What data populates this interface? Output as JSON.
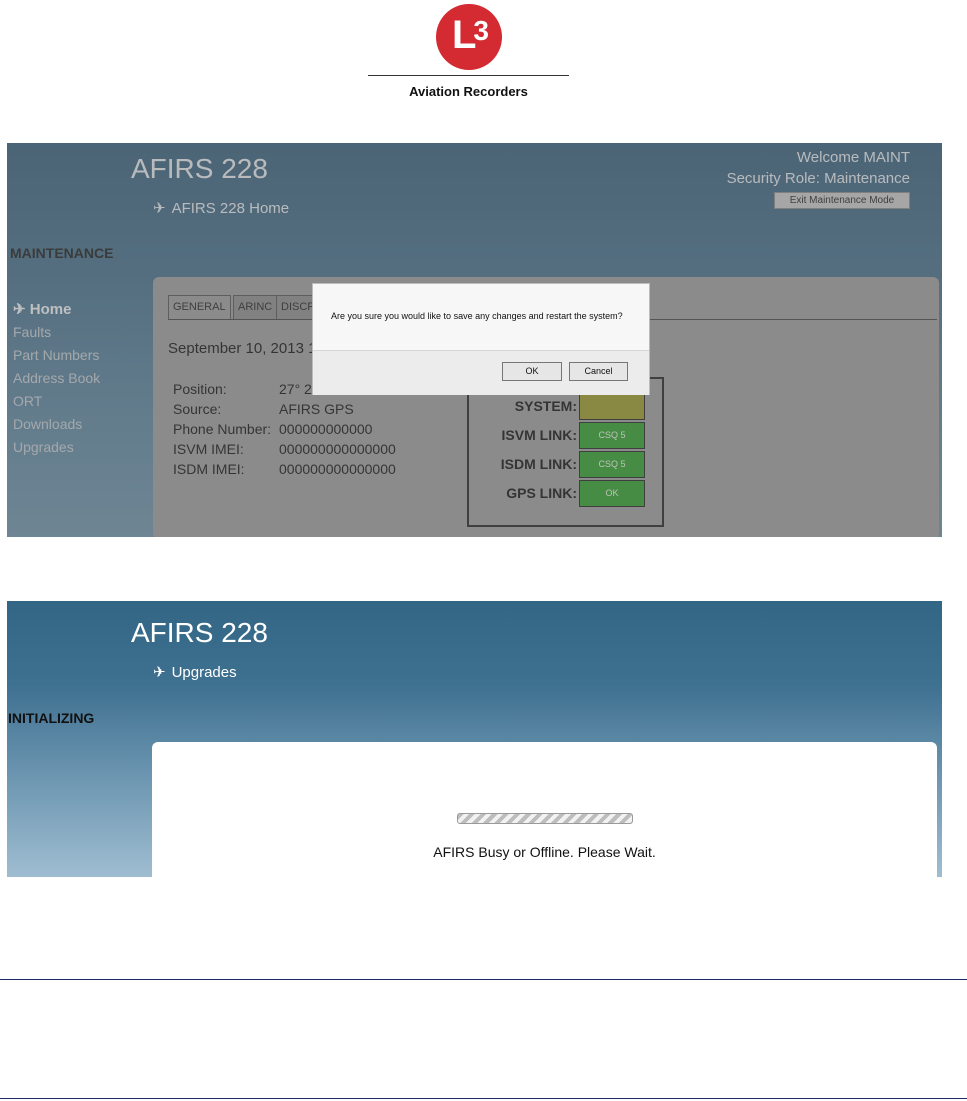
{
  "logo": {
    "mark_letter": "L",
    "mark_number": "3",
    "caption": "Aviation Recorders",
    "color": "#d42a32"
  },
  "screen1": {
    "app_title": "AFIRS 228",
    "breadcrumb": "AFIRS 228 Home",
    "welcome": "Welcome MAINT",
    "security_role": "Security Role: Maintenance",
    "exit_button": "Exit Maintenance Mode",
    "mode_label": "MAINTENANCE",
    "nav": [
      "Home",
      "Faults",
      "Part Numbers",
      "Address Book",
      "ORT",
      "Downloads",
      "Upgrades"
    ],
    "tabs": [
      "GENERAL",
      "ARINC",
      "DISCR"
    ],
    "date_text": "September 10, 2013 1",
    "info": [
      {
        "label": "Position:",
        "value": "27° 2"
      },
      {
        "label": "Source:",
        "value": "AFIRS GPS"
      },
      {
        "label": "Phone Number:",
        "value": "000000000000"
      },
      {
        "label": "ISVM IMEI:",
        "value": "000000000000000"
      },
      {
        "label": "ISDM IMEI:",
        "value": "000000000000000"
      }
    ],
    "status": [
      {
        "label": "SYSTEM:",
        "value": "",
        "color": "#9c9a2a"
      },
      {
        "label": "ISVM LINK:",
        "value": "CSQ 5",
        "color": "#2f9e2a"
      },
      {
        "label": "ISDM LINK:",
        "value": "CSQ 5",
        "color": "#2f9e2a"
      },
      {
        "label": "GPS LINK:",
        "value": "OK",
        "color": "#2f9e2a"
      }
    ],
    "dialog": {
      "message": "Are you sure you would like to save any changes and restart the system?",
      "ok_label": "OK",
      "cancel_label": "Cancel"
    }
  },
  "screen2": {
    "app_title": "AFIRS 228",
    "breadcrumb": "Upgrades",
    "mode_label": "INITIALIZING",
    "status_message": "AFIRS Busy or Offline. Please Wait."
  }
}
